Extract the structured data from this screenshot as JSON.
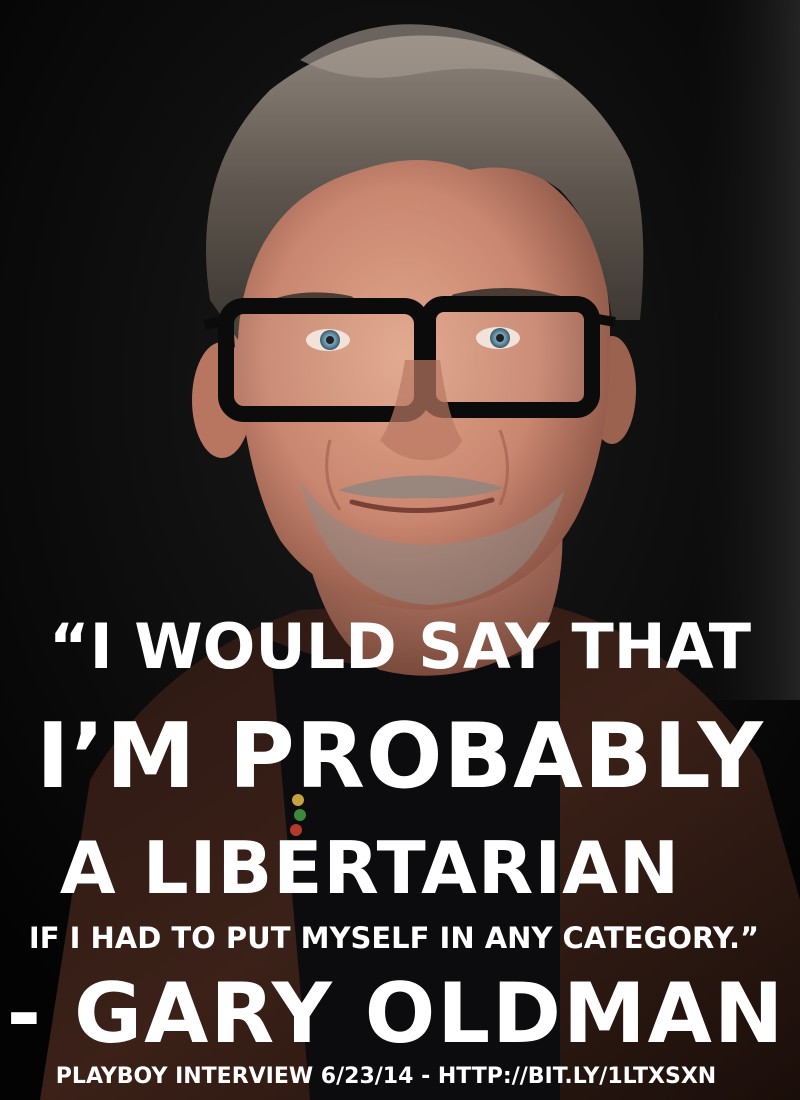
{
  "poster": {
    "quote_line_1": "“I WOULD SAY THAT",
    "quote_line_2": "I’M PROBABLY",
    "quote_line_3": "A LIBERTARIAN",
    "quote_line_4": "IF I HAD TO PUT MYSELF IN ANY CATEGORY.”",
    "attribution": "- GARY OLDMAN",
    "source": "PLAYBOY INTERVIEW 6/23/14 - HTTP://BIT.LY/1LTXSXN"
  },
  "colors": {
    "background": "#050505",
    "text": "#ffffff"
  }
}
